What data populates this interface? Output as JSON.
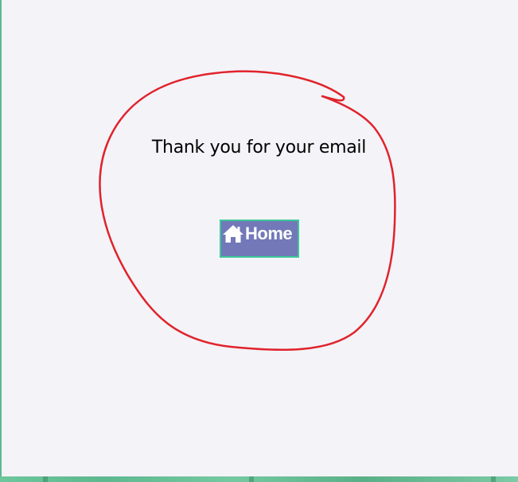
{
  "page": {
    "background_color": "#f4f3f8",
    "accent_green": "#5fb98f"
  },
  "main": {
    "message": "Thank you for your email",
    "home_button": {
      "label": "Home",
      "icon": "home-icon",
      "background_color": "#7278b8",
      "border_color": "#3cc79a"
    }
  },
  "annotation": {
    "shape": "hand-drawn circle",
    "color": "#e0232b"
  }
}
